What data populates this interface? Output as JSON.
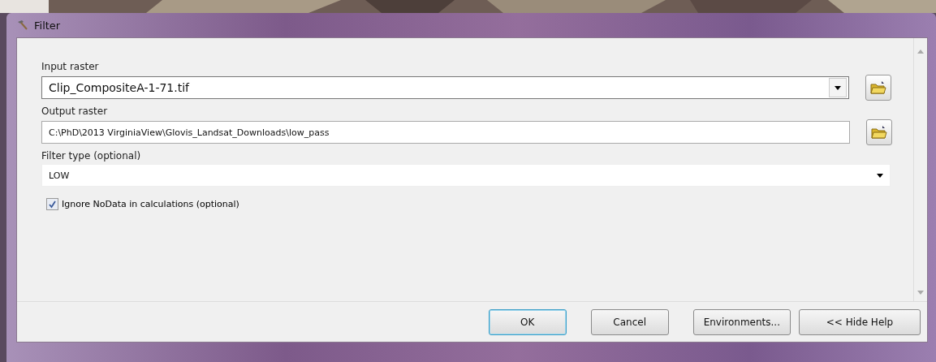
{
  "window": {
    "title": "Filter"
  },
  "input_raster": {
    "label": "Input raster",
    "value": "Clip_CompositeA-1-71.tif"
  },
  "output_raster": {
    "label": "Output raster",
    "value": "C:\\PhD\\2013 VirginiaView\\Glovis_Landsat_Downloads\\low_pass"
  },
  "filter_type": {
    "label": "Filter type (optional)",
    "value": "LOW"
  },
  "ignore_nodata": {
    "label": "Ignore NoData in calculations (optional)",
    "checked": true
  },
  "buttons": [
    {
      "label": "OK",
      "default": true
    },
    {
      "label": "Cancel",
      "default": false
    },
    {
      "label": "Environments...",
      "default": false
    },
    {
      "label": "<< Hide Help",
      "default": false
    }
  ]
}
